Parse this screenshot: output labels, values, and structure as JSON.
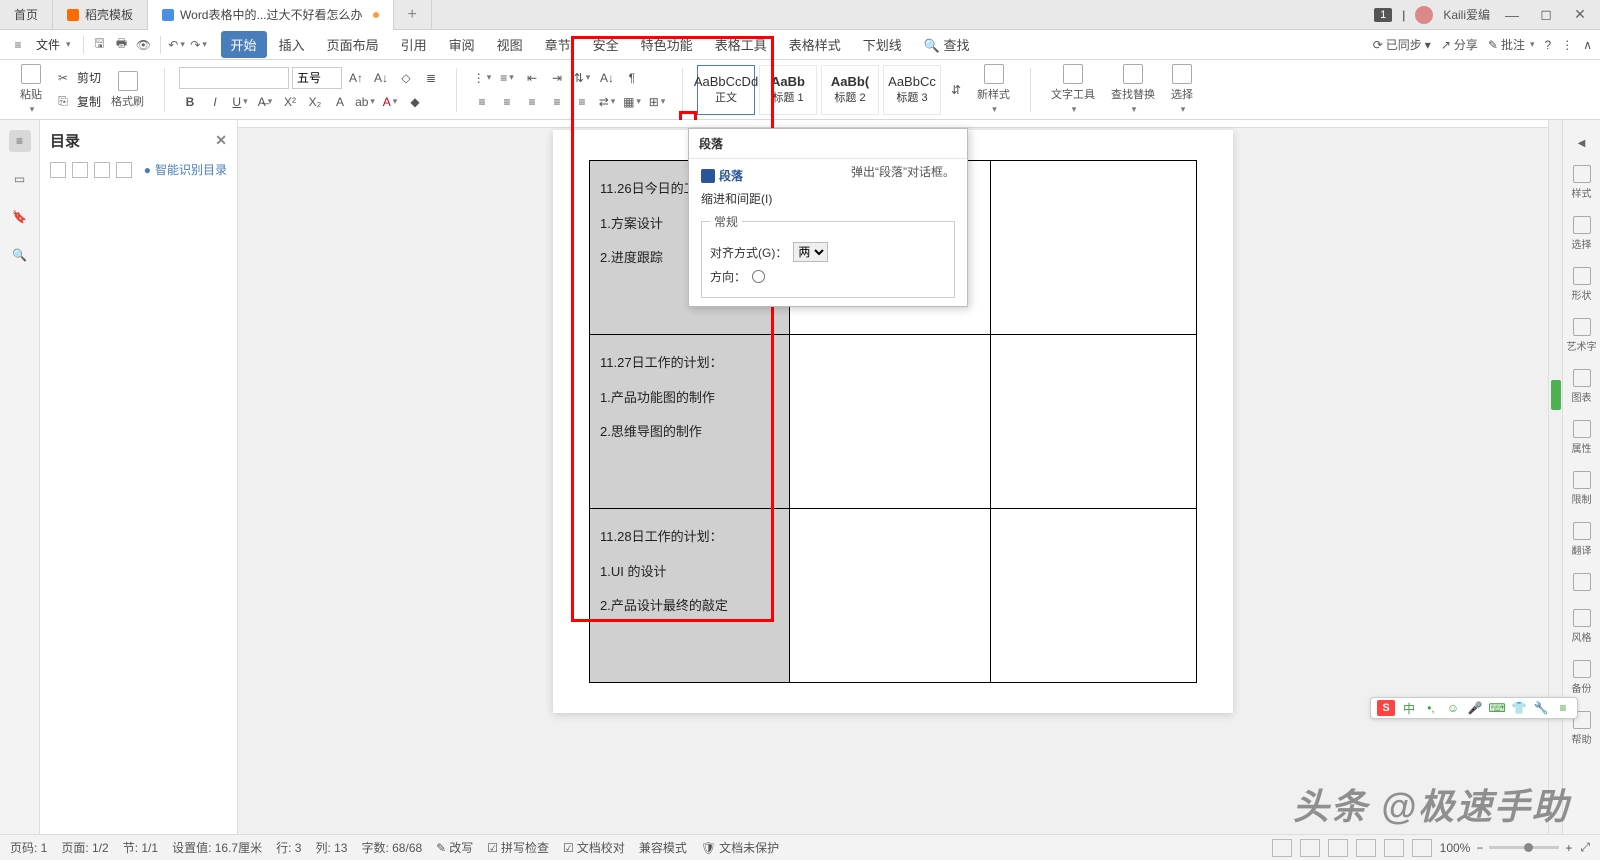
{
  "titlebar": {
    "tabs": [
      {
        "label": "首页",
        "icon": ""
      },
      {
        "label": "稻壳模板",
        "icon": "orange"
      },
      {
        "label": "Word表格中的...过大不好看怎么办",
        "icon": "blue",
        "active": true,
        "dirty": true
      }
    ],
    "badge": "1",
    "user": "Kaili爱编"
  },
  "menubar": {
    "file": "文件",
    "tabs": [
      "开始",
      "插入",
      "页面布局",
      "引用",
      "审阅",
      "视图",
      "章节",
      "安全",
      "特色功能",
      "表格工具",
      "表格样式",
      "下划线"
    ],
    "active": "开始",
    "search_label": "查找",
    "sync": "已同步",
    "share": "分享",
    "批注": "批注"
  },
  "ribbon": {
    "paste": "粘贴",
    "cut": "剪切",
    "copy": "复制",
    "format_painter": "格式刷",
    "font_size": "五号",
    "styles": [
      {
        "preview": "AaBbCcDd",
        "name": "正文",
        "active": true
      },
      {
        "preview": "AaBb",
        "name": "标题 1"
      },
      {
        "preview": "AaBb(",
        "name": "标题 2"
      },
      {
        "preview": "AaBbCc",
        "name": "标题 3"
      }
    ],
    "new_style": "新样式",
    "text_tool": "文字工具",
    "find_replace": "查找替换",
    "select": "选择"
  },
  "sidepanel": {
    "title": "目录",
    "smart": "智能识别目录"
  },
  "document": {
    "rows": [
      {
        "lines": [
          "11.26日今日的工",
          "1.方案设计",
          "2.进度跟踪"
        ]
      },
      {
        "lines": [
          "11.27日工作的计划：",
          "1.产品功能图的制作",
          "2.思维导图的制作"
        ]
      },
      {
        "lines": [
          "11.28日工作的计划：",
          "1.UI 的设计",
          "2.产品设计最终的敲定"
        ]
      }
    ]
  },
  "para_popup": {
    "header": "段落",
    "title": "段落",
    "hint": "弹出“段落”对话框。",
    "tab1": "缩进和间距(I)",
    "group": "常规",
    "align_label": "对齐方式(G)：",
    "align_value": "两",
    "dir_label": "方向："
  },
  "rightbar": {
    "items": [
      "样式",
      "选择",
      "形状",
      "艺术字",
      "图表",
      "属性",
      "限制",
      "翻译",
      "",
      "风格",
      "备份",
      "帮助"
    ]
  },
  "statusbar": {
    "page": "页码: 1",
    "pages": "页面: 1/2",
    "section": "节: 1/1",
    "setting": "设置值: 16.7厘米",
    "row": "行: 3",
    "col": "列: 13",
    "words": "字数: 68/68",
    "rewrite": "改写",
    "spell": "拼写检查",
    "proof": "文档校对",
    "compat": "兼容模式",
    "protect": "文档未保护",
    "zoom": "100%"
  },
  "watermark": "头条 @极速手助",
  "ime": {
    "lang": "中"
  }
}
